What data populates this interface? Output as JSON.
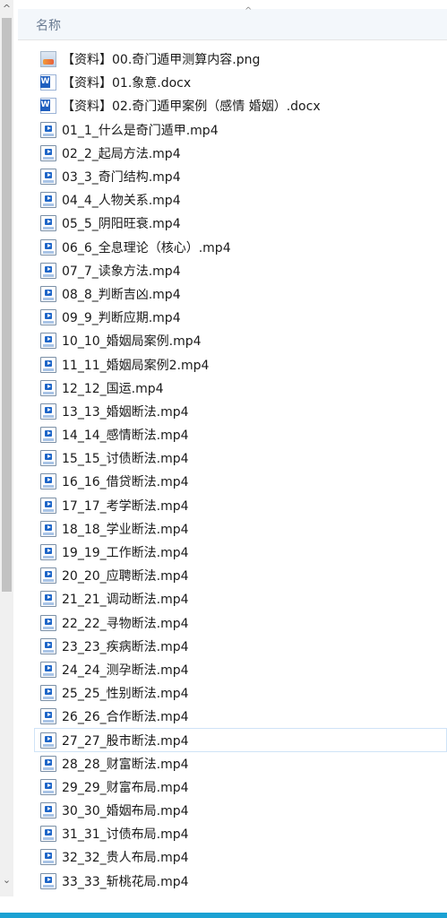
{
  "header": {
    "column_name": "名称"
  },
  "files": [
    {
      "name": "【资料】00.奇门遁甲测算内容.png",
      "type": "png"
    },
    {
      "name": "【资料】01.象意.docx",
      "type": "docx"
    },
    {
      "name": "【资料】02.奇门遁甲案例（感情 婚姻）.docx",
      "type": "docx"
    },
    {
      "name": "01_1_什么是奇门遁甲.mp4",
      "type": "mp4"
    },
    {
      "name": "02_2_起局方法.mp4",
      "type": "mp4"
    },
    {
      "name": "03_3_奇门结构.mp4",
      "type": "mp4"
    },
    {
      "name": "04_4_人物关系.mp4",
      "type": "mp4"
    },
    {
      "name": "05_5_阴阳旺衰.mp4",
      "type": "mp4"
    },
    {
      "name": "06_6_全息理论（核心）.mp4",
      "type": "mp4"
    },
    {
      "name": "07_7_读象方法.mp4",
      "type": "mp4"
    },
    {
      "name": "08_8_判断吉凶.mp4",
      "type": "mp4"
    },
    {
      "name": "09_9_判断应期.mp4",
      "type": "mp4"
    },
    {
      "name": "10_10_婚姻局案例.mp4",
      "type": "mp4"
    },
    {
      "name": "11_11_婚姻局案例2.mp4",
      "type": "mp4"
    },
    {
      "name": "12_12_国运.mp4",
      "type": "mp4"
    },
    {
      "name": "13_13_婚姻断法.mp4",
      "type": "mp4"
    },
    {
      "name": "14_14_感情断法.mp4",
      "type": "mp4"
    },
    {
      "name": "15_15_讨债断法.mp4",
      "type": "mp4"
    },
    {
      "name": "16_16_借贷断法.mp4",
      "type": "mp4"
    },
    {
      "name": "17_17_考学断法.mp4",
      "type": "mp4"
    },
    {
      "name": "18_18_学业断法.mp4",
      "type": "mp4"
    },
    {
      "name": "19_19_工作断法.mp4",
      "type": "mp4"
    },
    {
      "name": "20_20_应聘断法.mp4",
      "type": "mp4"
    },
    {
      "name": "21_21_调动断法.mp4",
      "type": "mp4"
    },
    {
      "name": "22_22_寻物断法.mp4",
      "type": "mp4"
    },
    {
      "name": "23_23_疾病断法.mp4",
      "type": "mp4"
    },
    {
      "name": "24_24_测孕断法.mp4",
      "type": "mp4"
    },
    {
      "name": "25_25_性别断法.mp4",
      "type": "mp4"
    },
    {
      "name": "26_26_合作断法.mp4",
      "type": "mp4"
    },
    {
      "name": "27_27_股市断法.mp4",
      "type": "mp4",
      "selected": true
    },
    {
      "name": "28_28_财富断法.mp4",
      "type": "mp4"
    },
    {
      "name": "29_29_财富布局.mp4",
      "type": "mp4"
    },
    {
      "name": "30_30_婚姻布局.mp4",
      "type": "mp4"
    },
    {
      "name": "31_31_讨债布局.mp4",
      "type": "mp4"
    },
    {
      "name": "32_32_贵人布局.mp4",
      "type": "mp4"
    },
    {
      "name": "33_33_斩桃花局.mp4",
      "type": "mp4"
    }
  ]
}
